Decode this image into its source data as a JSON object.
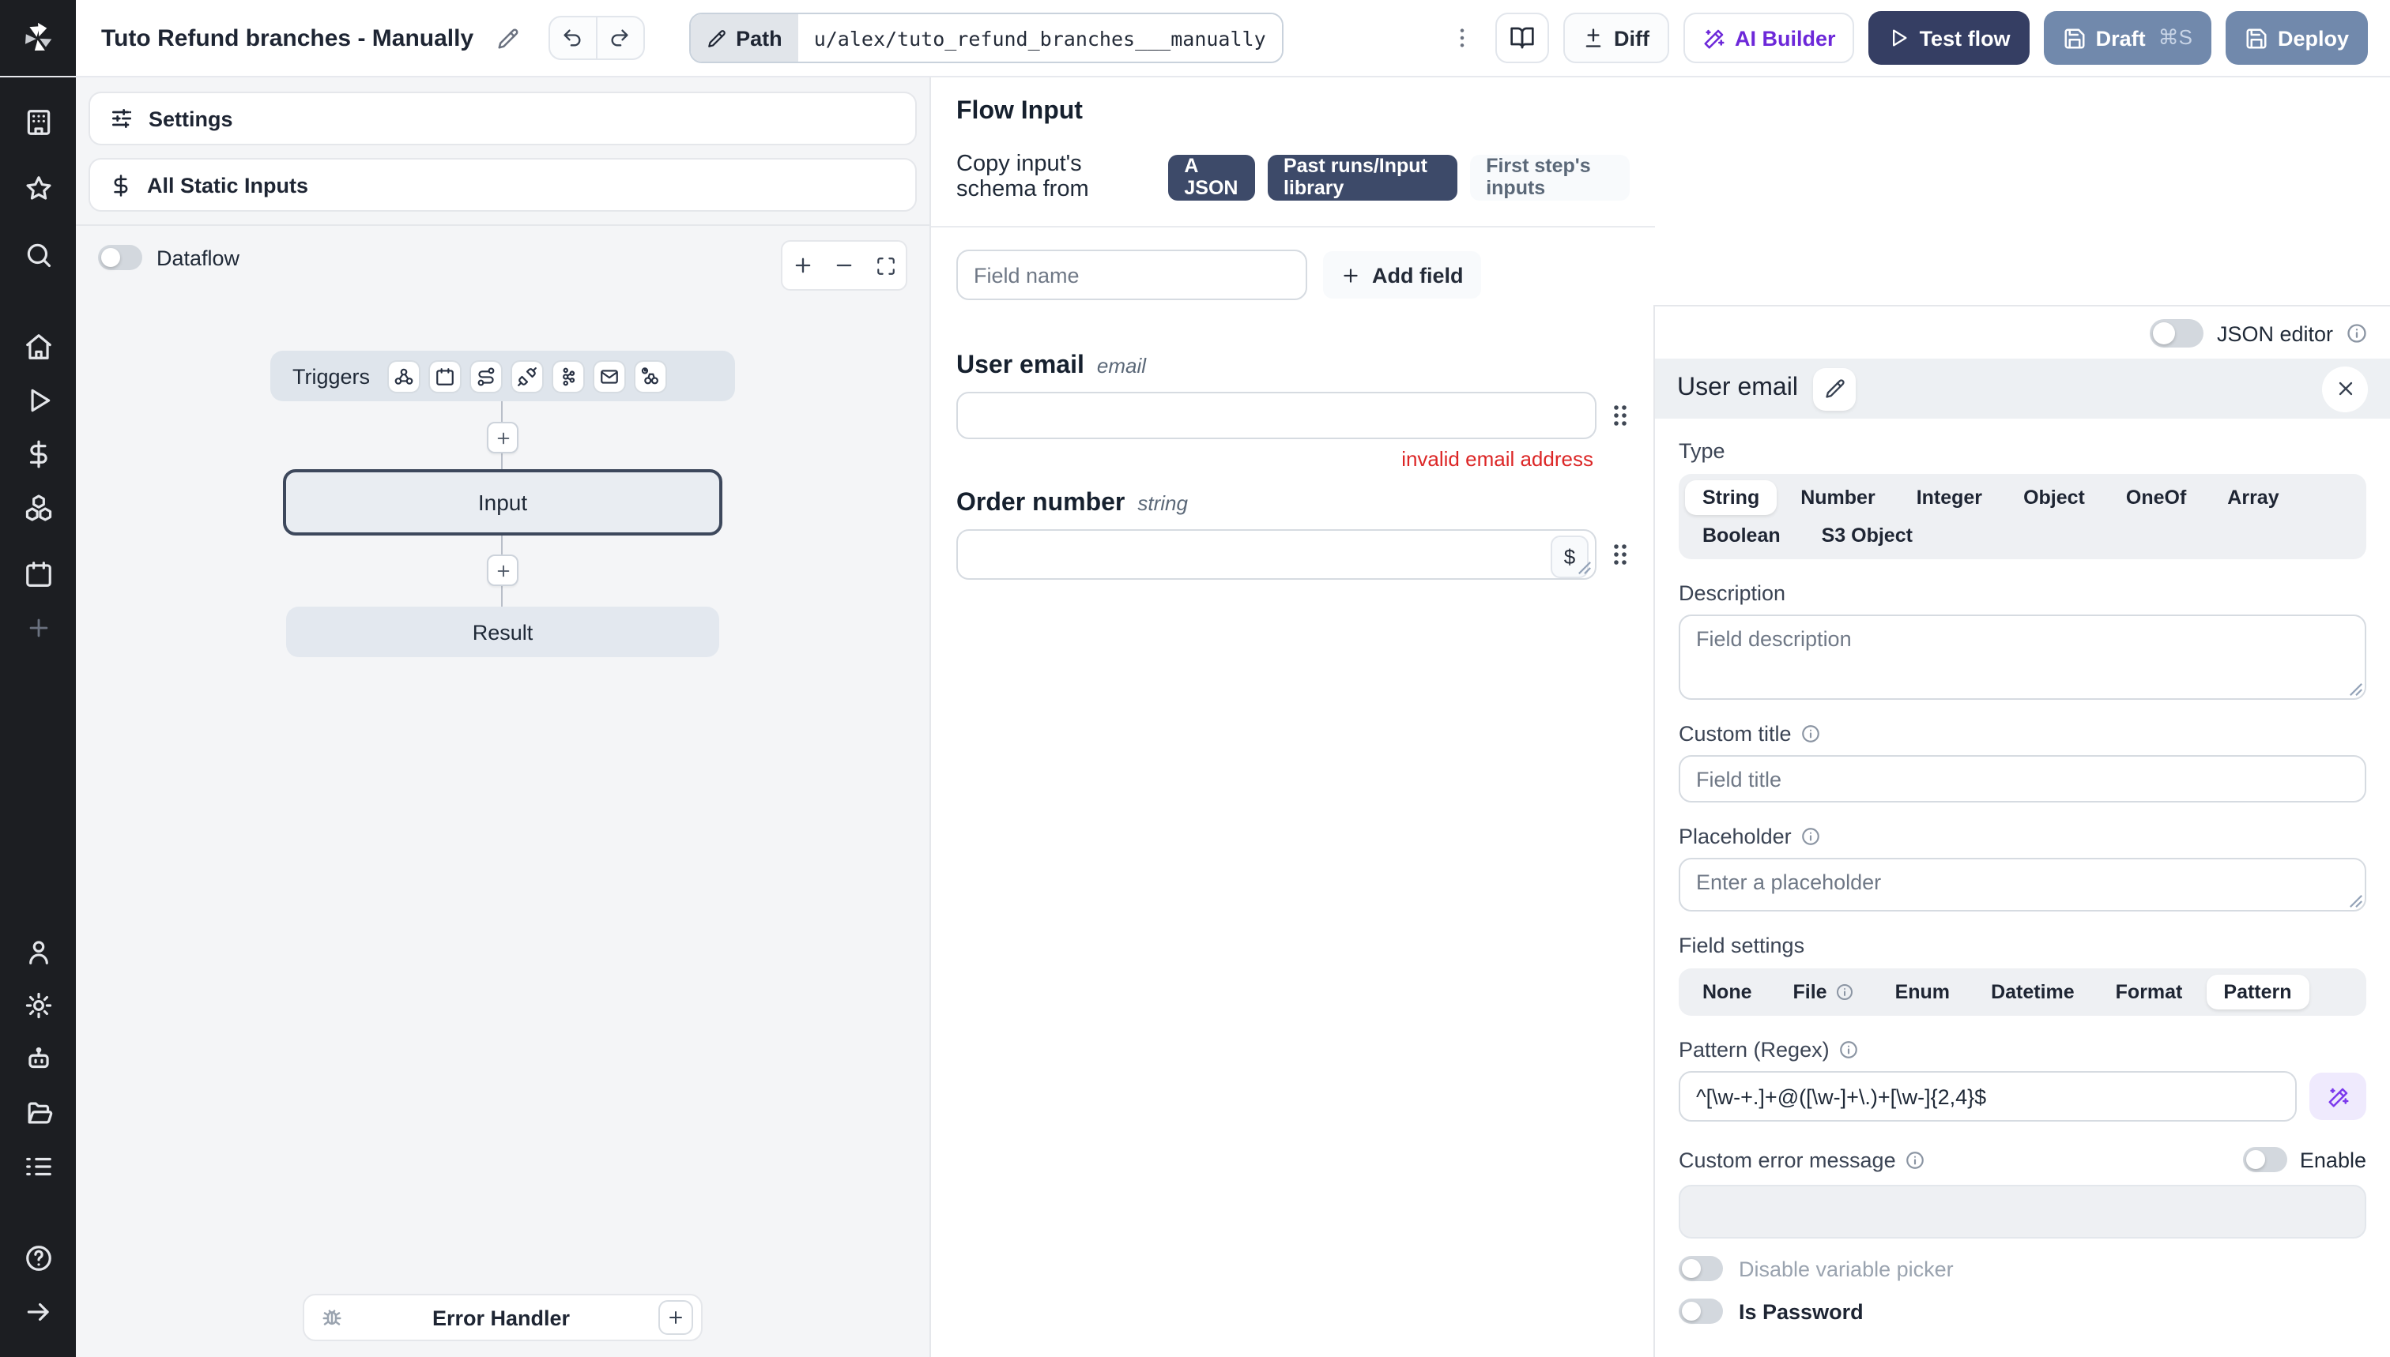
{
  "topbar": {
    "title": "Tuto Refund branches - Manually",
    "path_label": "Path",
    "path_value": "u/alex/tuto_refund_branches___manually",
    "diff_label": "Diff",
    "ai_builder_label": "AI Builder",
    "test_flow_label": "Test flow",
    "draft_label": "Draft",
    "draft_shortcut": "⌘S",
    "deploy_label": "Deploy"
  },
  "sidebar": {
    "icons": [
      "workspace",
      "favorites",
      "search",
      "home",
      "runs",
      "variables",
      "resources",
      "schedules",
      "add",
      "user",
      "settings",
      "workers",
      "folders",
      "logs",
      "help",
      "expand"
    ]
  },
  "flow_panel": {
    "settings_label": "Settings",
    "static_inputs_label": "All Static Inputs",
    "dataflow_label": "Dataflow",
    "triggers_label": "Triggers",
    "trigger_icons": [
      "webhook",
      "schedule",
      "http-route",
      "websocket",
      "kafka",
      "email",
      "poll"
    ],
    "input_node_label": "Input",
    "result_node_label": "Result",
    "error_handler_label": "Error Handler"
  },
  "middle_panel": {
    "heading": "Flow Input",
    "copy_schema_label": "Copy input's schema from",
    "copy_buttons": [
      "A JSON",
      "Past runs/Input library",
      "First step's inputs"
    ],
    "field_name_placeholder": "Field name",
    "add_field_label": "Add field",
    "fields": [
      {
        "name": "User email",
        "type": "email",
        "error": "invalid email address"
      },
      {
        "name": "Order number",
        "type": "string"
      }
    ]
  },
  "right_panel": {
    "json_editor_label": "JSON editor",
    "field_title": "User email",
    "type_label": "Type",
    "types": [
      "String",
      "Number",
      "Integer",
      "Object",
      "OneOf",
      "Array",
      "Boolean",
      "S3 Object"
    ],
    "selected_type": "String",
    "description_label": "Description",
    "description_placeholder": "Field description",
    "custom_title_label": "Custom title",
    "custom_title_placeholder": "Field title",
    "placeholder_label": "Placeholder",
    "placeholder_placeholder": "Enter a placeholder",
    "field_settings_label": "Field settings",
    "field_settings_options": [
      "None",
      "File",
      "Enum",
      "Datetime",
      "Format",
      "Pattern"
    ],
    "selected_setting": "Pattern",
    "pattern_label": "Pattern (Regex)",
    "pattern_value": "^[\\w-+.]+@([\\w-]+\\.)+[\\w-]{2,4}$",
    "custom_error_label": "Custom error message",
    "enable_label": "Enable",
    "disable_variable_picker_label": "Disable variable picker",
    "is_password_label": "Is Password"
  },
  "colors": {
    "primary_dark": "#353e63",
    "secondary_slate": "#7189ac",
    "dark_pill": "#3d4a69",
    "ai_purple": "#7c3aed",
    "error_red": "#dc2626",
    "rail_bg": "#1c1e22",
    "canvas_bg": "#f4f5f7"
  }
}
